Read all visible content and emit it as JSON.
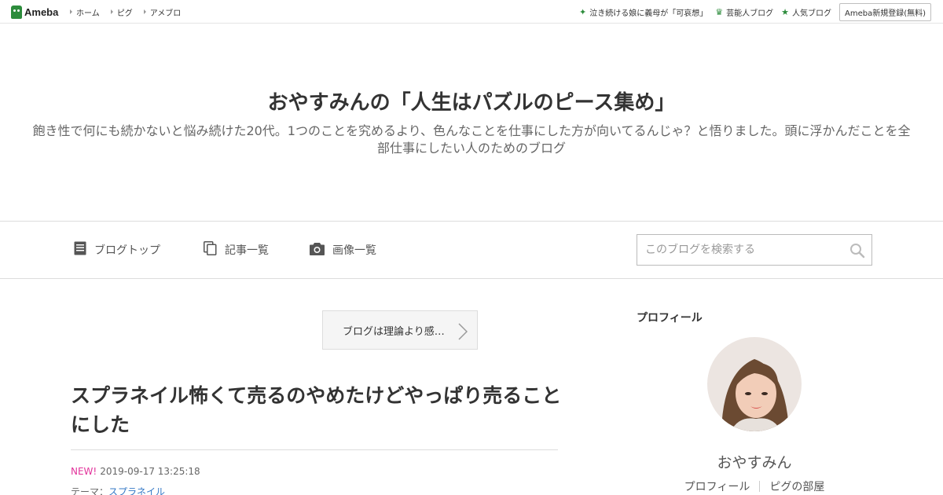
{
  "topbar": {
    "logo_text": "Ameba",
    "nav": [
      "ホーム",
      "ピグ",
      "アメブロ"
    ],
    "right_links": [
      {
        "label": "泣き続ける娘に義母が「可哀想」",
        "icon": "sparkle-icon"
      },
      {
        "label": "芸能人ブログ",
        "icon": "crown-icon"
      },
      {
        "label": "人気ブログ",
        "icon": "star-icon"
      }
    ],
    "register_label": "Ameba新規登録(無料)"
  },
  "header": {
    "title": "おやすみんの「人生はパズルのピース集め」",
    "description": "飽き性で何にも続かないと悩み続けた20代。1つのことを究めるより、色んなことを仕事にした方が向いてるんじゃ？と悟りました。頭に浮かんだことを全部仕事にしたい人のためのブログ"
  },
  "navbar": {
    "items": [
      "ブログトップ",
      "記事一覧",
      "画像一覧"
    ],
    "search_placeholder": "このブログを検索する"
  },
  "article": {
    "prev_label": "ブログは理論より感…",
    "title": "スプラネイル怖くて売るのやめたけどやっぱり売ることにした",
    "new_badge": "NEW!",
    "timestamp": "2019-09-17 13:25:18",
    "theme_label": "テーマ：",
    "theme_value": "スプラネイル"
  },
  "sidebar": {
    "heading": "プロフィール",
    "name": "おやすみん",
    "links": [
      "プロフィール",
      "ピグの部屋"
    ]
  },
  "colors": {
    "brand_green": "#2d8c3c",
    "new_badge": "#e2339b",
    "link_blue": "#3478c6"
  }
}
